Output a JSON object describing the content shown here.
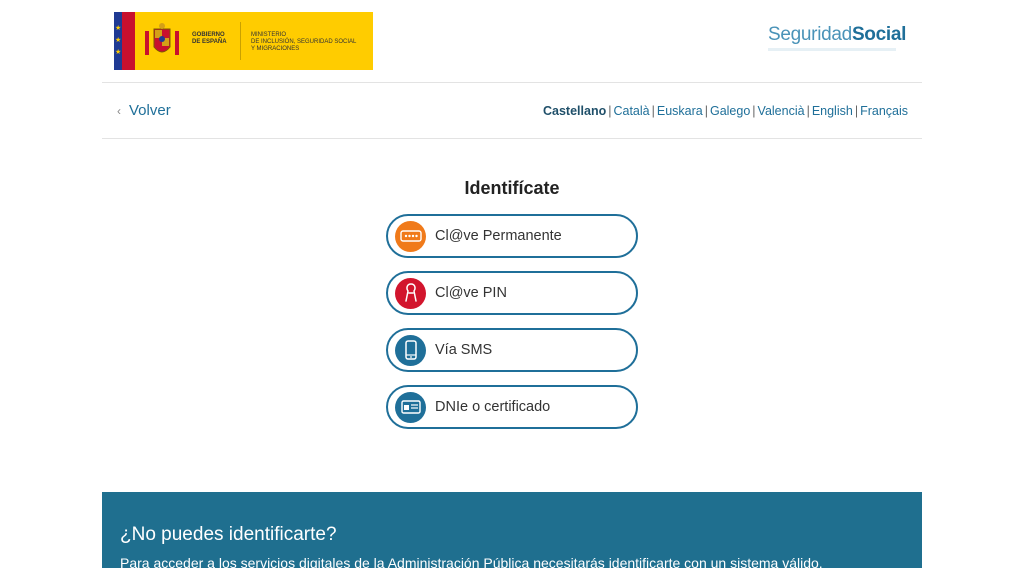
{
  "header": {
    "gov_label_line1": "Gobierno",
    "gov_label_line2": "de España",
    "ministry_line1": "Ministerio",
    "ministry_line2": "de Inclusión, Seguridad Social",
    "ministry_line3": "y Migraciones",
    "logo_light": "Seguridad",
    "logo_bold": "Social"
  },
  "nav": {
    "back_label": "Volver",
    "languages": [
      "Castellano",
      "Català",
      "Euskara",
      "Galego",
      "Valencià",
      "English",
      "Français"
    ],
    "active_language": "Castellano"
  },
  "main": {
    "title": "Identifícate",
    "options": [
      {
        "label": "Cl@ve Permanente",
        "icon": "password-icon",
        "color": "#f07a1a"
      },
      {
        "label": "Cl@ve PIN",
        "icon": "pin-code-icon",
        "color": "#d2152d"
      },
      {
        "label": "Vía SMS",
        "icon": "mobile-phone-icon",
        "color": "#1f6f99"
      },
      {
        "label": "DNIe o certificado",
        "icon": "id-card-icon",
        "color": "#1f6f99"
      }
    ]
  },
  "footer": {
    "heading": "¿No puedes identificarte?",
    "text": "Para acceder a los servicios digitales de la Administración Pública necesitarás identificarte con un sistema válido."
  },
  "colors": {
    "primary": "#1f6f99",
    "band": "#1f6f8f",
    "gov_yellow": "#ffcc00"
  }
}
